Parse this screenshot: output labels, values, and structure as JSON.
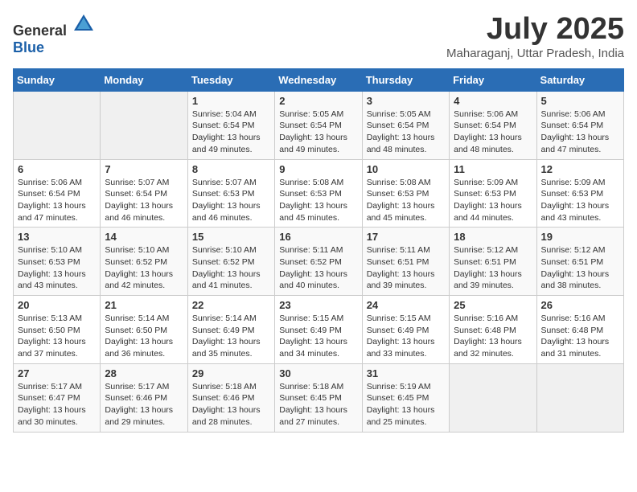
{
  "header": {
    "logo_general": "General",
    "logo_blue": "Blue",
    "month_year": "July 2025",
    "location": "Maharaganj, Uttar Pradesh, India"
  },
  "weekdays": [
    "Sunday",
    "Monday",
    "Tuesday",
    "Wednesday",
    "Thursday",
    "Friday",
    "Saturday"
  ],
  "weeks": [
    [
      {
        "day": "",
        "info": ""
      },
      {
        "day": "",
        "info": ""
      },
      {
        "day": "1",
        "info": "Sunrise: 5:04 AM\nSunset: 6:54 PM\nDaylight: 13 hours and 49 minutes."
      },
      {
        "day": "2",
        "info": "Sunrise: 5:05 AM\nSunset: 6:54 PM\nDaylight: 13 hours and 49 minutes."
      },
      {
        "day": "3",
        "info": "Sunrise: 5:05 AM\nSunset: 6:54 PM\nDaylight: 13 hours and 48 minutes."
      },
      {
        "day": "4",
        "info": "Sunrise: 5:06 AM\nSunset: 6:54 PM\nDaylight: 13 hours and 48 minutes."
      },
      {
        "day": "5",
        "info": "Sunrise: 5:06 AM\nSunset: 6:54 PM\nDaylight: 13 hours and 47 minutes."
      }
    ],
    [
      {
        "day": "6",
        "info": "Sunrise: 5:06 AM\nSunset: 6:54 PM\nDaylight: 13 hours and 47 minutes."
      },
      {
        "day": "7",
        "info": "Sunrise: 5:07 AM\nSunset: 6:54 PM\nDaylight: 13 hours and 46 minutes."
      },
      {
        "day": "8",
        "info": "Sunrise: 5:07 AM\nSunset: 6:53 PM\nDaylight: 13 hours and 46 minutes."
      },
      {
        "day": "9",
        "info": "Sunrise: 5:08 AM\nSunset: 6:53 PM\nDaylight: 13 hours and 45 minutes."
      },
      {
        "day": "10",
        "info": "Sunrise: 5:08 AM\nSunset: 6:53 PM\nDaylight: 13 hours and 45 minutes."
      },
      {
        "day": "11",
        "info": "Sunrise: 5:09 AM\nSunset: 6:53 PM\nDaylight: 13 hours and 44 minutes."
      },
      {
        "day": "12",
        "info": "Sunrise: 5:09 AM\nSunset: 6:53 PM\nDaylight: 13 hours and 43 minutes."
      }
    ],
    [
      {
        "day": "13",
        "info": "Sunrise: 5:10 AM\nSunset: 6:53 PM\nDaylight: 13 hours and 43 minutes."
      },
      {
        "day": "14",
        "info": "Sunrise: 5:10 AM\nSunset: 6:52 PM\nDaylight: 13 hours and 42 minutes."
      },
      {
        "day": "15",
        "info": "Sunrise: 5:10 AM\nSunset: 6:52 PM\nDaylight: 13 hours and 41 minutes."
      },
      {
        "day": "16",
        "info": "Sunrise: 5:11 AM\nSunset: 6:52 PM\nDaylight: 13 hours and 40 minutes."
      },
      {
        "day": "17",
        "info": "Sunrise: 5:11 AM\nSunset: 6:51 PM\nDaylight: 13 hours and 39 minutes."
      },
      {
        "day": "18",
        "info": "Sunrise: 5:12 AM\nSunset: 6:51 PM\nDaylight: 13 hours and 39 minutes."
      },
      {
        "day": "19",
        "info": "Sunrise: 5:12 AM\nSunset: 6:51 PM\nDaylight: 13 hours and 38 minutes."
      }
    ],
    [
      {
        "day": "20",
        "info": "Sunrise: 5:13 AM\nSunset: 6:50 PM\nDaylight: 13 hours and 37 minutes."
      },
      {
        "day": "21",
        "info": "Sunrise: 5:14 AM\nSunset: 6:50 PM\nDaylight: 13 hours and 36 minutes."
      },
      {
        "day": "22",
        "info": "Sunrise: 5:14 AM\nSunset: 6:49 PM\nDaylight: 13 hours and 35 minutes."
      },
      {
        "day": "23",
        "info": "Sunrise: 5:15 AM\nSunset: 6:49 PM\nDaylight: 13 hours and 34 minutes."
      },
      {
        "day": "24",
        "info": "Sunrise: 5:15 AM\nSunset: 6:49 PM\nDaylight: 13 hours and 33 minutes."
      },
      {
        "day": "25",
        "info": "Sunrise: 5:16 AM\nSunset: 6:48 PM\nDaylight: 13 hours and 32 minutes."
      },
      {
        "day": "26",
        "info": "Sunrise: 5:16 AM\nSunset: 6:48 PM\nDaylight: 13 hours and 31 minutes."
      }
    ],
    [
      {
        "day": "27",
        "info": "Sunrise: 5:17 AM\nSunset: 6:47 PM\nDaylight: 13 hours and 30 minutes."
      },
      {
        "day": "28",
        "info": "Sunrise: 5:17 AM\nSunset: 6:46 PM\nDaylight: 13 hours and 29 minutes."
      },
      {
        "day": "29",
        "info": "Sunrise: 5:18 AM\nSunset: 6:46 PM\nDaylight: 13 hours and 28 minutes."
      },
      {
        "day": "30",
        "info": "Sunrise: 5:18 AM\nSunset: 6:45 PM\nDaylight: 13 hours and 27 minutes."
      },
      {
        "day": "31",
        "info": "Sunrise: 5:19 AM\nSunset: 6:45 PM\nDaylight: 13 hours and 25 minutes."
      },
      {
        "day": "",
        "info": ""
      },
      {
        "day": "",
        "info": ""
      }
    ]
  ]
}
